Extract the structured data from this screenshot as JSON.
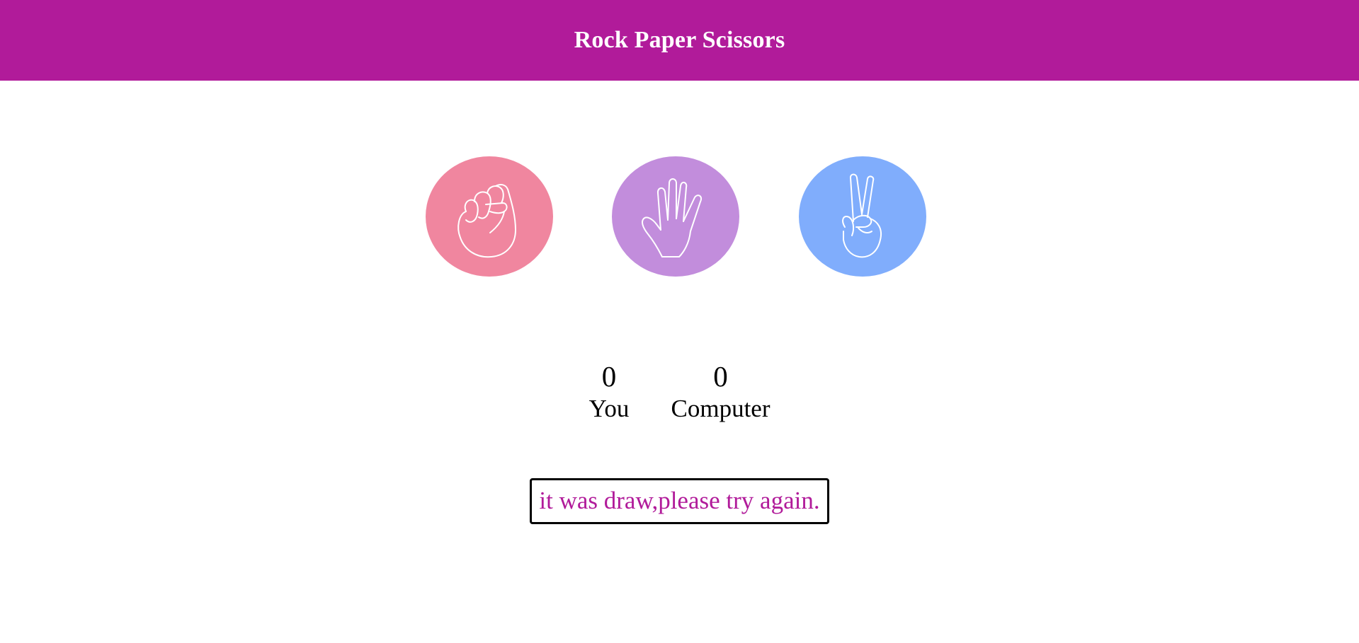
{
  "header": {
    "title": "Rock Paper Scissors",
    "background": "#b11b9a"
  },
  "choices": [
    {
      "id": "rock",
      "icon": "fist-hand-icon",
      "color": "#f0869f"
    },
    {
      "id": "paper",
      "icon": "open-hand-icon",
      "color": "#c28ddc"
    },
    {
      "id": "scissors",
      "icon": "peace-hand-icon",
      "color": "#80adfc"
    }
  ],
  "scoreboard": {
    "user_score": "0",
    "user_label": "You",
    "computer_score": "0",
    "computer_label": "Computer"
  },
  "message": {
    "text": "it was draw,please try again.",
    "color": "#b11b9a"
  }
}
